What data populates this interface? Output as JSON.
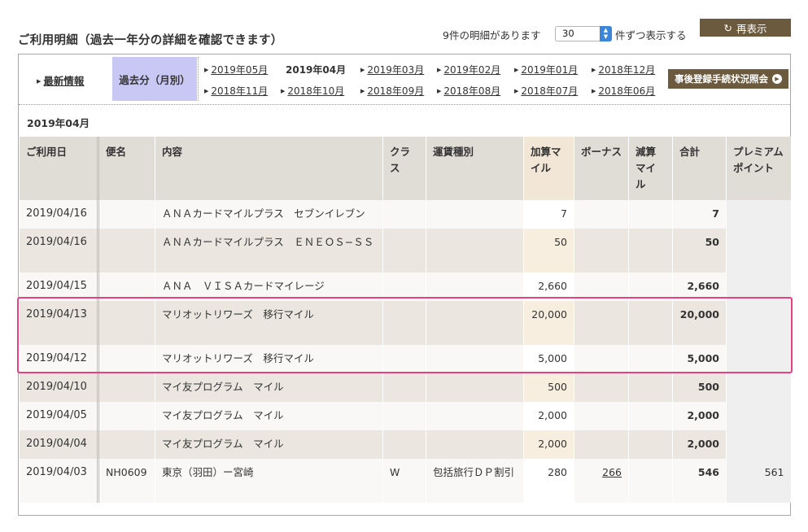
{
  "page": {
    "title": "ご利用明細（過去一年分の詳細を確認できます）",
    "count_text": "9件の明細があります",
    "per_page_value": "30",
    "per_page_suffix": "件ずつ表示する",
    "refresh_label": "再表示"
  },
  "nav": {
    "recent_label": "最新情報",
    "past_label": "過去分（月別）",
    "months_row1": [
      "2019年05月",
      "2019年04月",
      "2019年03月",
      "2019年02月",
      "2019年01月",
      "2018年12月"
    ],
    "months_row2": [
      "2018年11月",
      "2018年10月",
      "2018年09月",
      "2018年08月",
      "2018年07月",
      "2018年06月"
    ],
    "post_registration_label": "事後登録手続状況照会"
  },
  "table": {
    "month_heading": "2019年04月",
    "headers": {
      "date": "ご利用日",
      "flight": "便名",
      "content": "内容",
      "class": "クラス",
      "fare_type": "運賃種別",
      "added_miles": "加算マイル",
      "bonus": "ボーナス",
      "deducted_miles": "減算マイル",
      "total": "合計",
      "premium_points": "プレミアムポイント"
    },
    "rows": [
      {
        "date": "2019/04/16",
        "flight": "",
        "content": "ＡＮＡカードマイルプラス　セブンイレブン",
        "class": "",
        "fare_type": "",
        "added": "7",
        "bonus": "",
        "deducted": "",
        "total": "7",
        "premium": ""
      },
      {
        "date": "2019/04/16",
        "flight": "",
        "content": "ＡＮＡカードマイルプラス　ＥＮＥＯＳ−ＳＳ",
        "class": "",
        "fare_type": "",
        "added": "50",
        "bonus": "",
        "deducted": "",
        "total": "50",
        "premium": ""
      },
      {
        "date": "2019/04/15",
        "flight": "",
        "content": "ＡＮＡ　ＶＩＳＡカードマイレージ",
        "class": "",
        "fare_type": "",
        "added": "2,660",
        "bonus": "",
        "deducted": "",
        "total": "2,660",
        "premium": ""
      },
      {
        "date": "2019/04/13",
        "flight": "",
        "content": "マリオットリワーズ　移行マイル",
        "class": "",
        "fare_type": "",
        "added": "20,000",
        "bonus": "",
        "deducted": "",
        "total": "20,000",
        "premium": ""
      },
      {
        "date": "2019/04/12",
        "flight": "",
        "content": "マリオットリワーズ　移行マイル",
        "class": "",
        "fare_type": "",
        "added": "5,000",
        "bonus": "",
        "deducted": "",
        "total": "5,000",
        "premium": ""
      },
      {
        "date": "2019/04/10",
        "flight": "",
        "content": "マイ友プログラム　マイル",
        "class": "",
        "fare_type": "",
        "added": "500",
        "bonus": "",
        "deducted": "",
        "total": "500",
        "premium": ""
      },
      {
        "date": "2019/04/05",
        "flight": "",
        "content": "マイ友プログラム　マイル",
        "class": "",
        "fare_type": "",
        "added": "2,000",
        "bonus": "",
        "deducted": "",
        "total": "2,000",
        "premium": ""
      },
      {
        "date": "2019/04/04",
        "flight": "",
        "content": "マイ友プログラム　マイル",
        "class": "",
        "fare_type": "",
        "added": "2,000",
        "bonus": "",
        "deducted": "",
        "total": "2,000",
        "premium": ""
      },
      {
        "date": "2019/04/03",
        "flight": "NH0609",
        "content": "東京（羽田）ー宮崎",
        "class": "W",
        "fare_type": "包括旅行ＤＰ割引",
        "added": "280",
        "bonus": "266",
        "deducted": "",
        "total": "546",
        "premium": "561"
      }
    ]
  },
  "colors": {
    "brand_button": "#6b5a3d",
    "past_tab_bg": "#c9c8f5",
    "header_bg": "#e0dcd6",
    "highlight_border": "#e64280"
  },
  "icons": {
    "refresh": "refresh-icon",
    "triangle": "triangle-right-icon",
    "circle_arrow": "circle-arrow-right-icon",
    "spinner": "spinner-arrows-icon"
  }
}
